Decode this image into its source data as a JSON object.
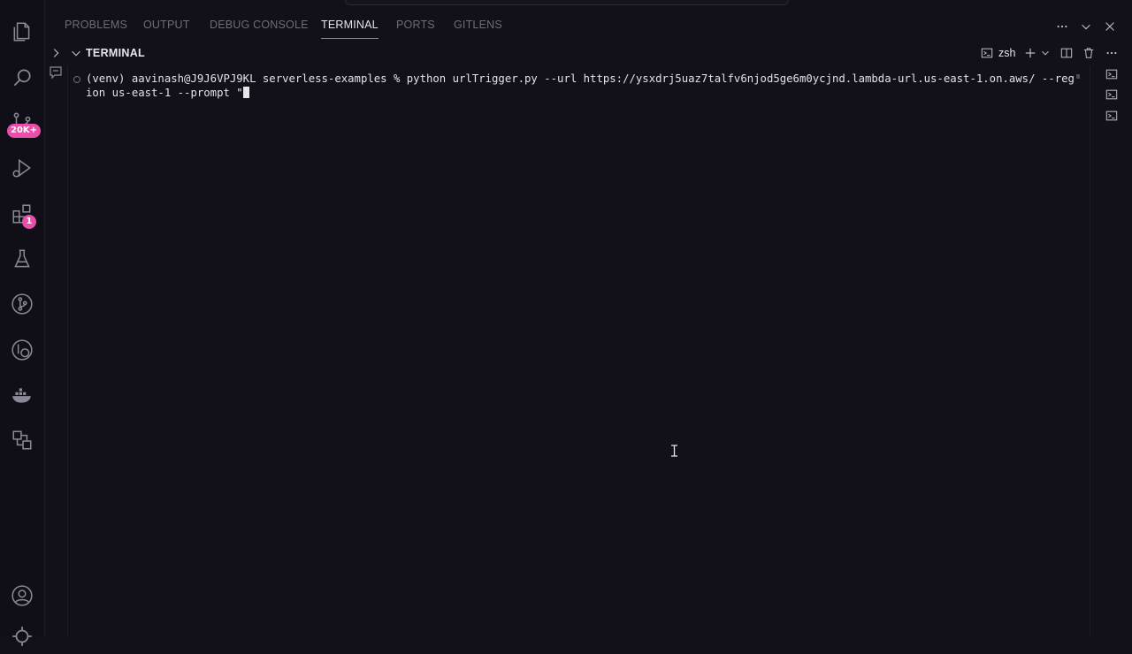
{
  "activity_bar": {
    "items": [
      {
        "icon": "files-icon"
      },
      {
        "icon": "search-icon"
      },
      {
        "icon": "source-control-icon",
        "badge": "20K+"
      },
      {
        "icon": "run-debug-icon"
      },
      {
        "icon": "extensions-icon",
        "badge": "1"
      },
      {
        "icon": "testing-icon"
      },
      {
        "icon": "git-graph-icon"
      },
      {
        "icon": "gitlens-icon"
      },
      {
        "icon": "docker-icon"
      },
      {
        "icon": "remote-explorer-icon"
      }
    ],
    "bottom": [
      {
        "icon": "account-icon"
      },
      {
        "icon": "settings-icon"
      }
    ]
  },
  "panel": {
    "tabs": [
      {
        "label": "PROBLEMS",
        "active": false
      },
      {
        "label": "OUTPUT",
        "active": false
      },
      {
        "label": "DEBUG CONSOLE",
        "active": false
      },
      {
        "label": "TERMINAL",
        "active": true
      },
      {
        "label": "PORTS",
        "active": false
      },
      {
        "label": "GITLENS",
        "active": false
      }
    ]
  },
  "terminal": {
    "title": "TERMINAL",
    "shell": "zsh",
    "line1": "(venv) aavinash@J9J6VPJ9KL serverless-examples % python urlTrigger.py --url https://ysxdrj5uaz7talfv6njod5ge6m0ycjnd.lambda-url.us-east-1.on.aws/ --reg",
    "line2": "ion us-east-1 --prompt \""
  },
  "colors": {
    "background": "#12111a",
    "accent": "#e94ea8"
  }
}
